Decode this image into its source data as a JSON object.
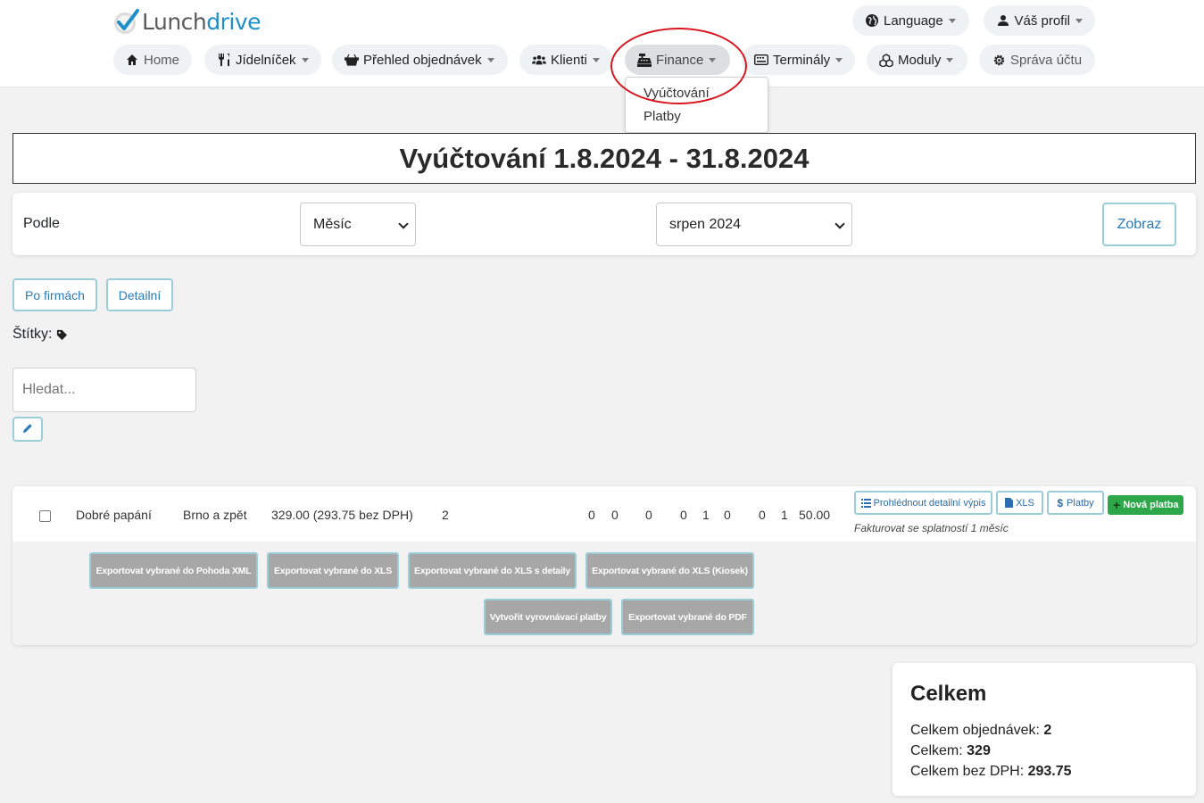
{
  "logo": {
    "lunch": "Lunch",
    "drive": "drive"
  },
  "nav": {
    "home": "Home",
    "menu": "Jídelníček",
    "orders": "Přehled objednávek",
    "clients": "Klienti",
    "finance": "Finance",
    "terminals": "Terminály",
    "modules": "Moduly",
    "account": "Správa účtu",
    "language": "Language",
    "profile": "Váš profil"
  },
  "finance_dropdown": [
    "Vyúčtování",
    "Platby"
  ],
  "page_title": "Vyúčtování 1.8.2024 - 31.8.2024",
  "filter": {
    "label": "Podle",
    "period_select": "Měsíc",
    "month_select": "srpen 2024",
    "show_button": "Zobraz"
  },
  "view_buttons": {
    "by_company": "Po firmách",
    "detailed": "Detailní"
  },
  "tags_label": "Štítky:",
  "search_placeholder": "Hledat...",
  "row": {
    "company": "Dobré papání",
    "location": "Brno a zpět",
    "amount": "329.00 (293.75 bez DPH)",
    "orders": "2",
    "counts": [
      "0",
      "0",
      "0",
      "0",
      "1",
      "0",
      "0",
      "1"
    ],
    "total": "50.00",
    "btn_detail": "Prohlédnout detailní výpis",
    "btn_xls": "XLS",
    "btn_payments": "Platby",
    "btn_new_payment": "Nová platba",
    "invoice_note": "Fakturovat se splatností 1 měsíc"
  },
  "export_buttons": [
    "Exportovat vybrané do Pohoda XML",
    "Exportovat vybrané do XLS",
    "Exportovat vybrané do XLS s detaily",
    "Exportovat vybrané do XLS (Kiosek)",
    "Vytvořit vyrovnávací platby",
    "Exportovat vybrané do PDF"
  ],
  "summary": {
    "title": "Celkem",
    "orders_label": "Celkem objednávek:",
    "orders_value": "2",
    "total_label": "Celkem:",
    "total_value": "329",
    "net_label": "Celkem bez DPH:",
    "net_value": "293.75"
  },
  "colors": {
    "accent": "#1e8fc8",
    "highlight": "#d8151f",
    "success": "#2ea74a",
    "export_gray": "#a7a7a7"
  }
}
